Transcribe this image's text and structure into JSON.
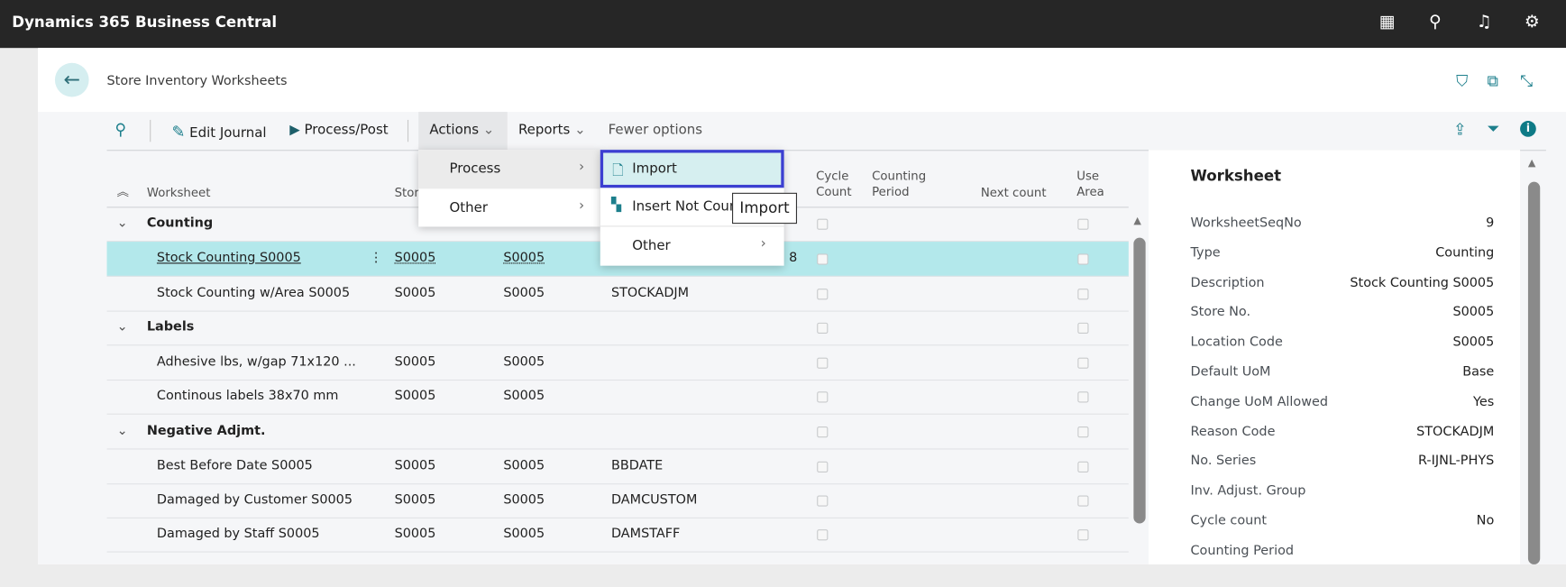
{
  "app": {
    "title": "Dynamics 365 Business Central",
    "icons": [
      "building-icon",
      "search-icon",
      "bell-icon",
      "gear-icon"
    ]
  },
  "page": {
    "title": "Store Inventory Worksheets",
    "icons": [
      "bookmark-icon",
      "open-new-window-icon",
      "collapse-icon"
    ]
  },
  "toolbar": {
    "edit_journal": "Edit Journal",
    "process_post": "Process/Post",
    "actions": "Actions",
    "reports": "Reports",
    "fewer_options": "Fewer options"
  },
  "actions_menu": {
    "items": [
      {
        "label": "Process"
      },
      {
        "label": "Other"
      }
    ]
  },
  "process_submenu": {
    "items": [
      {
        "label": "Import"
      },
      {
        "label": "Insert Not Coun"
      },
      {
        "label": "Other"
      }
    ]
  },
  "tooltip": "Import",
  "table": {
    "headers": {
      "worksheet": "Worksheet",
      "store": "Store",
      "cycle_count": [
        "Cycle",
        "Count"
      ],
      "counting_period": [
        "Counting",
        "Period"
      ],
      "next_count": "Next count",
      "use_area": [
        "Use",
        "Area"
      ]
    },
    "rows": [
      {
        "type": "group",
        "name": "Counting"
      },
      {
        "type": "item",
        "name": "Stock Counting S0005",
        "store": "S0005",
        "location": "S0005",
        "reason": "",
        "extra": "8",
        "selected": true
      },
      {
        "type": "item",
        "name": "Stock Counting w/Area S0005",
        "store": "S0005",
        "location": "S0005",
        "reason": "STOCKADJM"
      },
      {
        "type": "group",
        "name": "Labels"
      },
      {
        "type": "item",
        "name": "Adhesive lbs, w/gap 71x120 ...",
        "store": "S0005",
        "location": "S0005",
        "reason": ""
      },
      {
        "type": "item",
        "name": "Continous labels 38x70 mm",
        "store": "S0005",
        "location": "S0005",
        "reason": ""
      },
      {
        "type": "group",
        "name": "Negative Adjmt."
      },
      {
        "type": "item",
        "name": "Best Before Date S0005",
        "store": "S0005",
        "location": "S0005",
        "reason": "BBDATE"
      },
      {
        "type": "item",
        "name": "Damaged by Customer S0005",
        "store": "S0005",
        "location": "S0005",
        "reason": "DAMCUSTOM"
      },
      {
        "type": "item",
        "name": "Damaged by Staff S0005",
        "store": "S0005",
        "location": "S0005",
        "reason": "DAMSTAFF"
      }
    ]
  },
  "factbox": {
    "title": "Worksheet",
    "fields": [
      {
        "label": "WorksheetSeqNo",
        "value": "9"
      },
      {
        "label": "Type",
        "value": "Counting"
      },
      {
        "label": "Description",
        "value": "Stock Counting S0005"
      },
      {
        "label": "Store No.",
        "value": "S0005"
      },
      {
        "label": "Location Code",
        "value": "S0005"
      },
      {
        "label": "Default UoM",
        "value": "Base"
      },
      {
        "label": "Change UoM Allowed",
        "value": "Yes"
      },
      {
        "label": "Reason Code",
        "value": "STOCKADJM"
      },
      {
        "label": "No. Series",
        "value": "R-IJNL-PHYS"
      },
      {
        "label": "Inv. Adjust. Group",
        "value": ""
      },
      {
        "label": "Cycle count",
        "value": "No"
      },
      {
        "label": "Counting Period",
        "value": ""
      }
    ]
  },
  "colors": {
    "accent": "#1d7f8c",
    "selected_row": "#b3e8eb",
    "focus_border": "#3c3fd1",
    "topbar": "#262626"
  }
}
